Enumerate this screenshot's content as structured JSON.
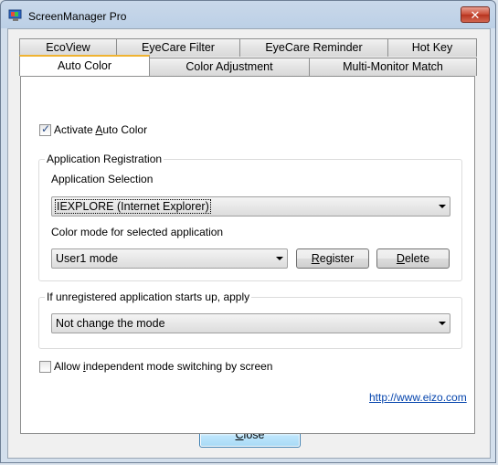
{
  "window": {
    "title": "ScreenManager Pro",
    "close_symbol": "✕"
  },
  "tabs_row1": [
    "EcoView",
    "EyeCare Filter",
    "EyeCare Reminder",
    "Hot Key"
  ],
  "tabs_row2": [
    "Auto Color",
    "Color Adjustment",
    "Multi-Monitor Match"
  ],
  "activate": {
    "pre": "Activate ",
    "key": "A",
    "post": "uto Color",
    "checked": true,
    "check_symbol": "✓"
  },
  "registration": {
    "group_title": "Application Registration",
    "selection_label": "Application Selection",
    "application_value": "IEXPLORE (Internet Explorer)",
    "color_mode_label": "Color mode for selected application",
    "color_mode_value": "User1 mode",
    "register": {
      "key": "R",
      "rest": "egister"
    },
    "delete": {
      "key": "D",
      "rest": "elete"
    }
  },
  "unregistered": {
    "group_title": "If unregistered application starts up, apply",
    "value": "Not change the mode"
  },
  "independent": {
    "pre": "Allow ",
    "key": "i",
    "post": "ndependent mode switching by screen",
    "checked": false
  },
  "link": "http://www.eizo.com",
  "close": {
    "key": "C",
    "rest": "lose"
  },
  "colors": {
    "accent_tab": "#f0b331",
    "link": "#0645ad",
    "close_red": "#c94b34"
  }
}
